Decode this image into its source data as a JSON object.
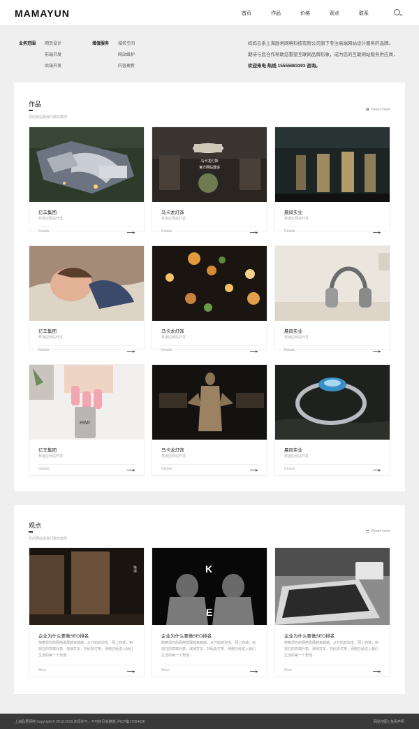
{
  "header": {
    "logo": "MAMAYUN",
    "nav": [
      "首页",
      "作品",
      "价格",
      "观点",
      "联系"
    ]
  },
  "services": [
    {
      "title": "业务范围",
      "items": [
        "网页设计",
        "前端开发",
        "后端开发"
      ]
    },
    {
      "title": "增值服务",
      "items": [
        "域名空间",
        "网站维护",
        "内容更新"
      ]
    }
  ],
  "company": {
    "line1": "妈妈云系上海励君网络科技有限公司旗下专注高端网站设计服务的品牌。",
    "line2": "期待与您合作帮助您重塑互联网品牌形象，成为您的互联网站服务供应商，",
    "hotline": "欢迎来电 热线 15555883393 咨询。"
  },
  "works": {
    "title": "作品",
    "subtitle": "您的网站最我们做的案例",
    "read_more": "Read more",
    "cards": [
      {
        "title": "亿丰集团",
        "sub": "林道应网站开发",
        "link": "Details"
      },
      {
        "title": "马卡龙灯饰",
        "sub": "林道应网站开发",
        "link": "Details",
        "overlay1": "马卡龙灯饰",
        "overlay2": "官方网站建设"
      },
      {
        "title": "晨风实业",
        "sub": "林道应网站开发",
        "link": "Details"
      },
      {
        "title": "亿丰集团",
        "sub": "林道应网站开发",
        "link": "Details"
      },
      {
        "title": "马卡龙灯饰",
        "sub": "林道应网站开发",
        "link": "Details"
      },
      {
        "title": "晨风实业",
        "sub": "林道应网站开发",
        "link": "Details"
      },
      {
        "title": "亿丰集团",
        "sub": "林道应网站开发",
        "link": "Details"
      },
      {
        "title": "马卡龙灯饰",
        "sub": "林道应网站开发",
        "link": "Details"
      },
      {
        "title": "晨风实业",
        "sub": "林道应网站开发",
        "link": "Details"
      }
    ]
  },
  "views": {
    "title": "观点",
    "subtitle": "您的网站最我们做的案例",
    "read_more": "Read more",
    "cards": [
      {
        "title": "企业为什么要做SEO排名",
        "desc": "随着现在的网络发展越来越越，从开始到淘宝、网上商城，到现在的高端外表、演演打车，扫码支付等，网络已经进入我们生活的每一个角落...",
        "link": "More",
        "img_text": "味道"
      },
      {
        "title": "企业为什么要做SEO排名",
        "desc": "随着现在的网络发展越来越越，从开始到淘宝、网上商城，到现在的高端外表、演演打车，扫码支付等，网络已经进入我们生活的每一个角落...",
        "link": "More",
        "img_k": "K",
        "img_e": "E"
      },
      {
        "title": "企业为什么要做SEO排名",
        "desc": "随着现在的网络发展越来越越，从开始到淘宝、网上商城，到现在的高端外表、演演打车，扫码支付等，网络已经进入我们生活的每一个角落...",
        "link": "More"
      }
    ]
  },
  "footer": {
    "copyright": "上海励君网络 Copyright © 2012-2018,未经许可，不可转贝或镜像   沪ICP备17004436",
    "links": "网站地图  |  免责声明"
  }
}
